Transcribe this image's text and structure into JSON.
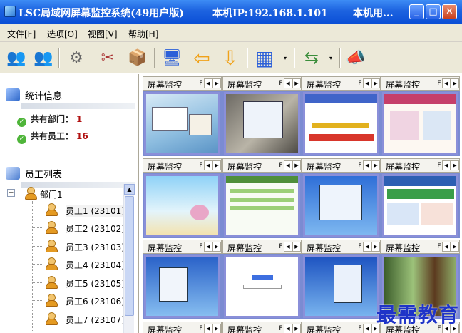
{
  "window": {
    "title": "LSC局域网屏幕监控系统(49用户版)",
    "ip_text": "本机IP:192.168.1.101",
    "user_text": "本机用...",
    "minimize_glyph": "_",
    "maximize_glyph": "□",
    "close_glyph": "✕"
  },
  "menu": [
    "文件[F]",
    "选项[O]",
    "视图[V]",
    "帮助[H]"
  ],
  "toolbar": {
    "buttons": [
      {
        "icon": "add-user-icon",
        "glyph": "👥"
      },
      {
        "icon": "remove-user-icon",
        "glyph": "👥"
      },
      {
        "icon": "gear-icon",
        "glyph": "⚙"
      },
      {
        "icon": "tools-icon",
        "glyph": "✂"
      },
      {
        "icon": "package-icon",
        "glyph": "📦"
      },
      {
        "icon": "monitor-icon",
        "glyph": "🖥"
      },
      {
        "icon": "arrow-left-icon",
        "glyph": "⇦"
      },
      {
        "icon": "arrow-down-icon",
        "glyph": "⇩"
      },
      {
        "icon": "grid-view-icon",
        "glyph": "▦"
      },
      {
        "icon": "transfer-icon",
        "glyph": "⇆"
      },
      {
        "icon": "broadcast-icon",
        "glyph": "📣"
      }
    ],
    "dropdown_glyph": "▾"
  },
  "stats": {
    "title": "统计信息",
    "departments_label": "共有部门：",
    "departments_value": "1",
    "employees_label": "共有员工：",
    "employees_value": "16"
  },
  "employee_list": {
    "title": "员工列表",
    "collapse_glyph": "−",
    "department": "部门1",
    "employees": [
      "员工1 (23101)",
      "员工2 (23102)",
      "员工3 (23103)",
      "员工4 (23104)",
      "员工5 (23105)",
      "员工6 (23106)",
      "员工7 (23107)"
    ],
    "scroll_up_glyph": "▲"
  },
  "monitor": {
    "tab_label": "屏幕监控",
    "tab_f_glyph": "F",
    "prev_glyph": "◀",
    "next_glyph": "▶",
    "cells": 16
  },
  "watermark": "最需教育",
  "colors": {
    "titlebar": "#1d63e0",
    "frame_border": "#7b8bd2",
    "stat_value": "#b01010",
    "watermark": "#1f34c8"
  }
}
